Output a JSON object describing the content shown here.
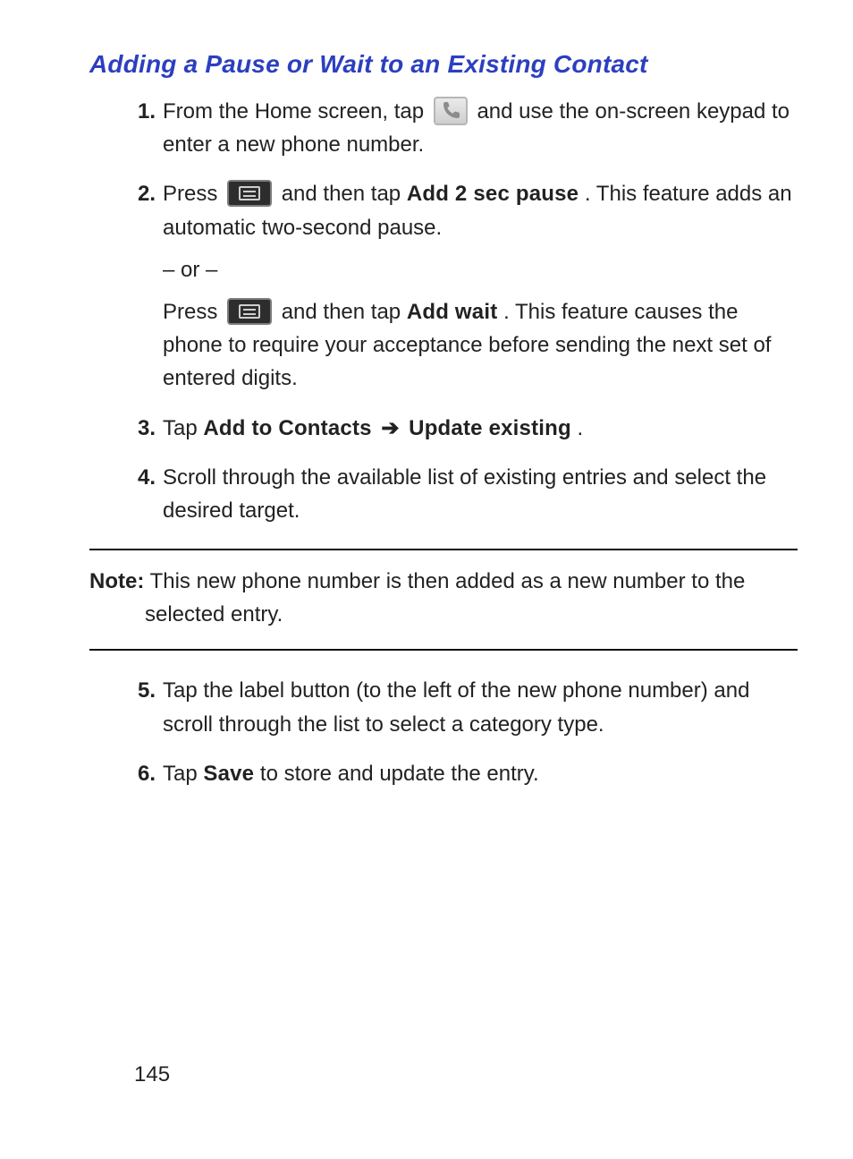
{
  "title": "Adding a Pause or Wait to an Existing Contact",
  "steps": {
    "s1": {
      "num": "1.",
      "a": "From the Home screen, tap ",
      "b": " and use the on-screen keypad to enter a new phone number."
    },
    "s2": {
      "num": "2.",
      "a": "Press ",
      "b": " and then tap ",
      "bold1": "Add 2 sec pause",
      "c": ". This feature adds an automatic two-second pause.",
      "or": "– or –",
      "d": "Press ",
      "e": " and then tap ",
      "bold2": "Add wait",
      "f": ". This feature causes the phone to require your acceptance before sending the next set of entered digits."
    },
    "s3": {
      "num": "3.",
      "a": "Tap ",
      "bold1": "Add to Contacts",
      "arrow": " ➔ ",
      "bold2": "Update existing",
      "b": "."
    },
    "s4": {
      "num": "4.",
      "a": "Scroll through the available list of existing entries and select the desired target."
    },
    "s5": {
      "num": "5.",
      "a": "Tap the label button (to the left of the new phone number) and scroll through the list to select a category type."
    },
    "s6": {
      "num": "6.",
      "a": "Tap ",
      "bold1": "Save",
      "b": " to store and update the entry."
    }
  },
  "note": {
    "label": "Note:",
    "text": " This new phone number is then added as a new number to the selected entry."
  },
  "page_number": "145"
}
